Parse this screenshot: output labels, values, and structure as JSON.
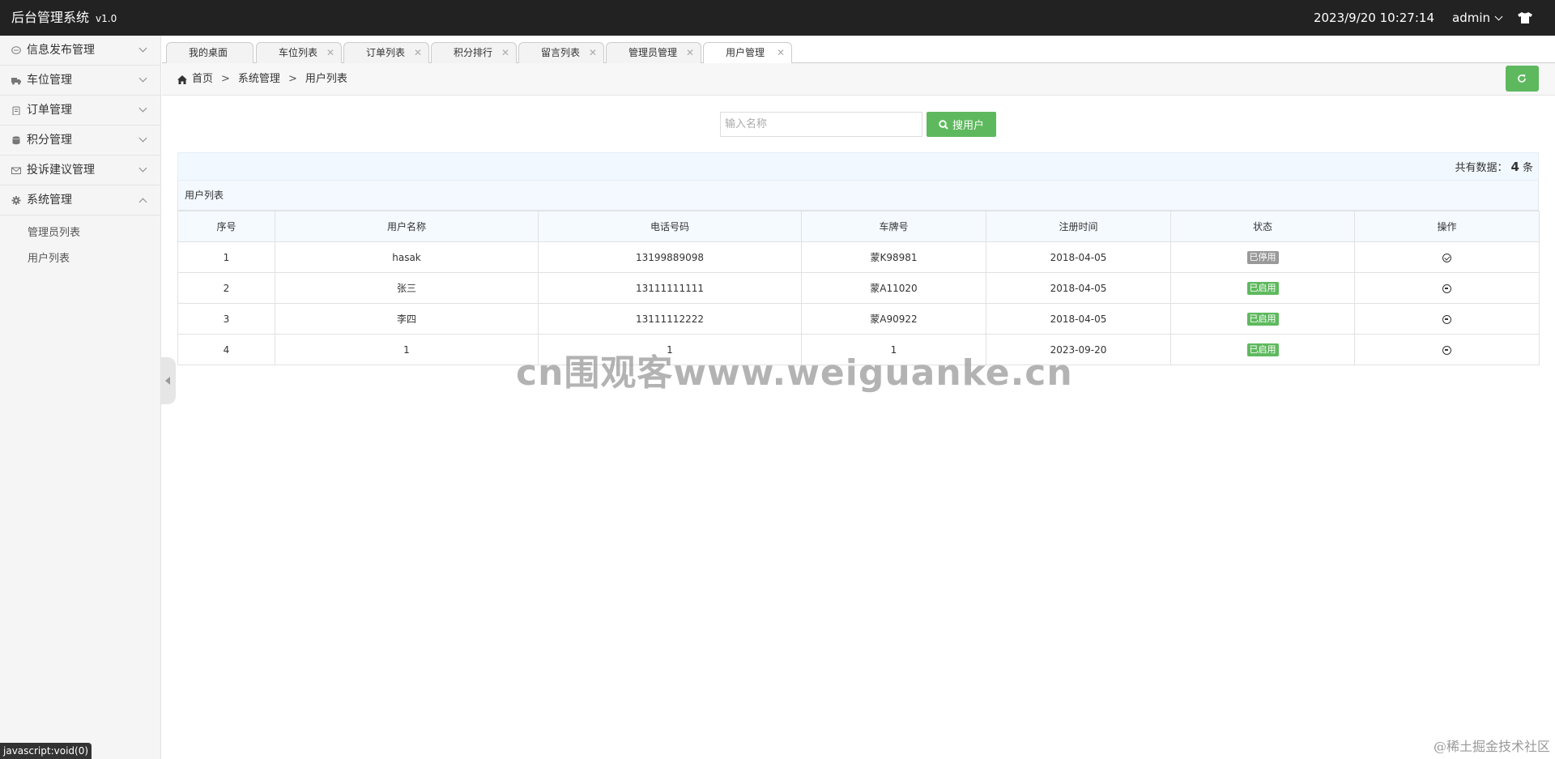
{
  "header": {
    "app_title": "后台管理系统",
    "version": "v1.0",
    "datetime": "2023/9/20 10:27:14",
    "user": "admin"
  },
  "sidebar": {
    "items": [
      {
        "label": "信息发布管理",
        "icon": "chat-bubble-icon"
      },
      {
        "label": "车位管理",
        "icon": "truck-icon"
      },
      {
        "label": "订单管理",
        "icon": "clipboard-icon"
      },
      {
        "label": "积分管理",
        "icon": "database-icon"
      },
      {
        "label": "投诉建议管理",
        "icon": "envelope-icon"
      },
      {
        "label": "系统管理",
        "icon": "gear-icon"
      }
    ],
    "sub_items": [
      "管理员列表",
      "用户列表"
    ]
  },
  "tabs": [
    "我的桌面",
    "车位列表",
    "订单列表",
    "积分排行",
    "留言列表",
    "管理员管理",
    "用户管理"
  ],
  "breadcrumb": {
    "home": "首页",
    "sep": ">",
    "section": "系统管理",
    "page": "用户列表"
  },
  "search": {
    "placeholder": "输入名称",
    "button_label": "搜用户"
  },
  "summary": {
    "prefix": "共有数据：",
    "count": "4",
    "suffix": "条"
  },
  "table": {
    "caption": "用户列表",
    "columns": [
      "序号",
      "用户名称",
      "电话号码",
      "车牌号",
      "注册时间",
      "状态",
      "操作"
    ],
    "rows": [
      {
        "idx": "1",
        "name": "hasak",
        "phone": "13199889098",
        "plate": "蒙K98981",
        "date": "2018-04-05",
        "status": "已停用",
        "enabled": false
      },
      {
        "idx": "2",
        "name": "张三",
        "phone": "13111111111",
        "plate": "蒙A11020",
        "date": "2018-04-05",
        "status": "已启用",
        "enabled": true
      },
      {
        "idx": "3",
        "name": "李四",
        "phone": "13111112222",
        "plate": "蒙A90922",
        "date": "2018-04-05",
        "status": "已启用",
        "enabled": true
      },
      {
        "idx": "4",
        "name": "1",
        "phone": "1",
        "plate": "1",
        "date": "2023-09-20",
        "status": "已启用",
        "enabled": true
      }
    ]
  },
  "watermark": "cn围观客www.weiguanke.cn",
  "statusbar": "javascript:void(0)",
  "credit": "@稀土掘金技术社区",
  "colors": {
    "header_bg": "#222222",
    "accent_green": "#5eb95e",
    "disabled_gray": "#999999"
  }
}
